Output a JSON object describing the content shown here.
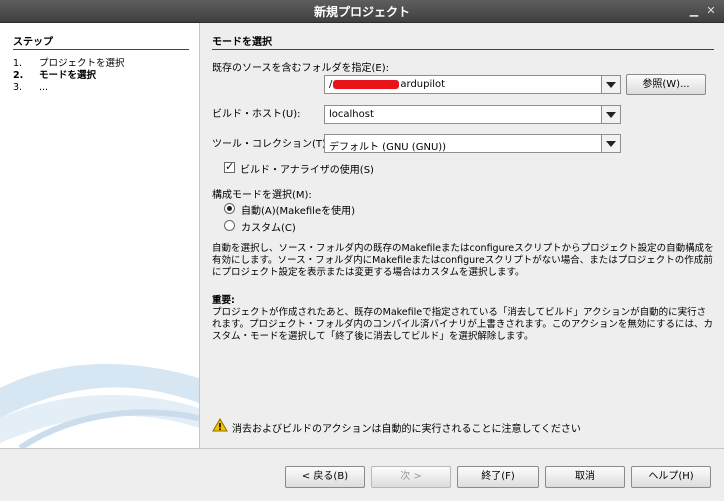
{
  "window": {
    "title": "新規プロジェクト"
  },
  "steps": {
    "heading": "ステップ",
    "items": [
      {
        "num": "1.",
        "label": "プロジェクトを選択"
      },
      {
        "num": "2.",
        "label": "モードを選択"
      },
      {
        "num": "3.",
        "label": "..."
      }
    ]
  },
  "form": {
    "section_title": "モードを選択",
    "source_folder_label": "既存のソースを含むフォルダを指定(E):",
    "source_folder_prefix": "/",
    "source_folder_suffix": "ardupilot",
    "browse_button": "参照(W)...",
    "build_host_label": "ビルド・ホスト(U):",
    "build_host_value": "localhost",
    "tool_collection_label": "ツール・コレクション(T):",
    "tool_collection_value": "デフォルト (GNU (GNU))",
    "build_analyzer_label": "ビルド・アナライザの使用(S)",
    "build_analyzer_checked": true,
    "config_mode_label": "構成モードを選択(M):",
    "mode_auto_label": "自動(A)(Makefileを使用)",
    "mode_custom_label": "カスタム(C)",
    "selected_mode": "auto",
    "description": "自動を選択し、ソース・フォルダ内の既存のMakefileまたはconfigureスクリプトからプロジェクト設定の自動構成を有効にします。ソース・フォルダ内にMakefileまたはconfigureスクリプトがない場合、またはプロジェクトの作成前にプロジェクト設定を表示または変更する場合はカスタムを選択します。",
    "important_heading": "重要:",
    "important_text": "プロジェクトが作成されたあと、既存のMakefileで指定されている「消去してビルド」アクションが自動的に実行されます。プロジェクト・フォルダ内のコンパイル済バイナリが上書きされます。このアクションを無効にするには、カスタム・モードを選択して「終了後に消去してビルド」を選択解除します。",
    "warning_text": "消去およびビルドのアクションは自動的に実行されることに注意してください"
  },
  "buttons": {
    "back": "< 戻る(B)",
    "next": "次 >",
    "finish": "終了(F)",
    "cancel": "取消",
    "help": "ヘルプ(H)"
  }
}
